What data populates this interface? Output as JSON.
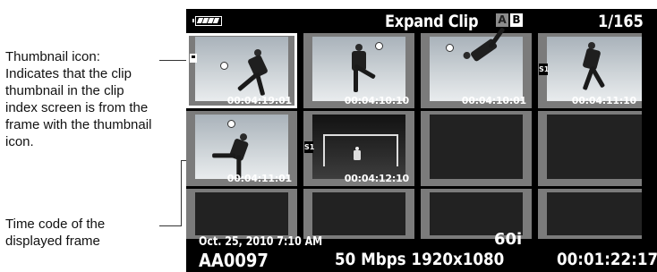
{
  "annotations": {
    "thumbnail_icon": "Thumbnail icon: Indicates that the clip thumbnail in the clip index screen is from the frame with the thumbnail icon.",
    "time_code": "Time code of the displayed frame"
  },
  "header": {
    "title": "Expand Clip",
    "slot_a": "A",
    "slot_b": "B",
    "counter": "1/165",
    "battery_icon": "battery-full-icon"
  },
  "thumbnails": [
    {
      "timecode": "00:04:19:01",
      "selected": true,
      "thumbnail_icon": true
    },
    {
      "timecode": "00:04:10:10"
    },
    {
      "timecode": "00:04:10:01"
    },
    {
      "timecode": "00:04:11:10",
      "marker": "S1"
    },
    {
      "timecode": "00:04:11:01"
    },
    {
      "timecode": "00:04:12:10",
      "marker": "S1"
    }
  ],
  "footer": {
    "date": "Oct. 25, 2010  7:10 AM",
    "frame_rate": "60i",
    "clip_name": "AA0097",
    "bitrate": "50 Mbps 1920x1080",
    "duration": "00:01:22:17"
  }
}
